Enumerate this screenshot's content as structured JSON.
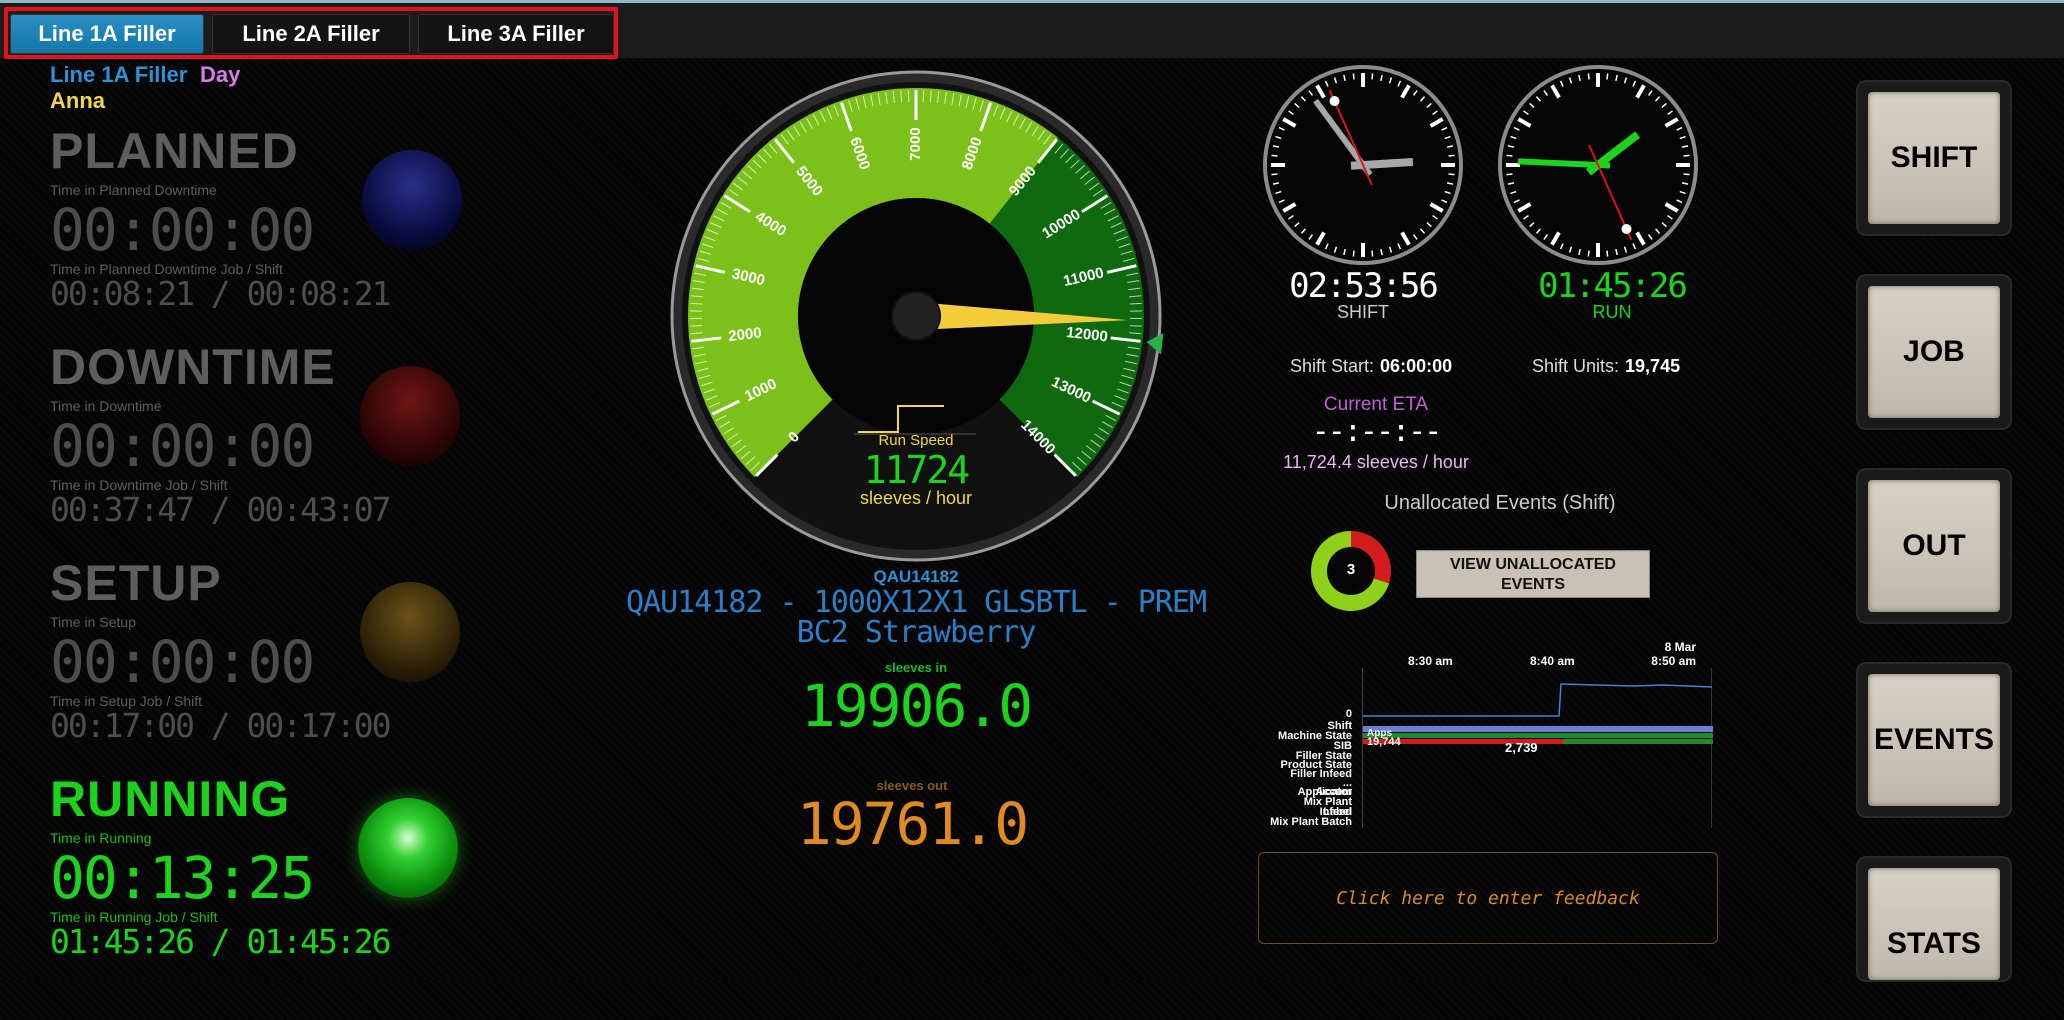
{
  "tabs": [
    {
      "label": "Line 1A Filler",
      "active": true
    },
    {
      "label": "Line 2A Filler",
      "active": false
    },
    {
      "label": "Line 3A Filler",
      "active": false
    }
  ],
  "header": {
    "line_name": "Line 1A Filler",
    "shift_name": "Day",
    "operator": "Anna"
  },
  "states": {
    "planned": {
      "title": "PLANNED",
      "time_label": "Time in Planned Downtime",
      "time": "00:00:00",
      "job_label": "Time in Planned Downtime Job / Shift",
      "job_time": "00:08:21 / 00:08:21"
    },
    "downtime": {
      "title": "DOWNTIME",
      "time_label": "Time in Downtime",
      "time": "00:00:00",
      "job_label": "Time in Downtime Job / Shift",
      "job_time": "00:37:47 / 00:43:07"
    },
    "setup": {
      "title": "SETUP",
      "time_label": "Time in Setup",
      "time": "00:00:00",
      "job_label": "Time in Setup Job / Shift",
      "job_time": "00:17:00 / 00:17:00"
    },
    "running": {
      "title": "RUNNING",
      "time_label": "Time in Running",
      "time": "00:13:25",
      "job_label": "Time in Running Job / Shift",
      "job_time": "01:45:26 / 01:45:26"
    }
  },
  "gauge": {
    "min": 0,
    "max": 14000,
    "value": 11724,
    "target": 12000,
    "ticks": [
      "0",
      "1000",
      "2000",
      "3000",
      "4000",
      "5000",
      "6000",
      "7000",
      "8000",
      "9000",
      "10000",
      "11000",
      "12000",
      "13000",
      "14000"
    ],
    "label": "Run Speed",
    "display_value": "11724",
    "unit": "sleeves / hour"
  },
  "job": {
    "code": "QAU14182",
    "description": "QAU14182 - 1000X12X1 GLSBTL - PREM BC2 Strawberry",
    "sleeves_in_label": "sleeves in",
    "sleeves_in_value": "19906.0",
    "sleeves_out_label": "sleeves out",
    "sleeves_out_value": "19761.0"
  },
  "clocks": {
    "shift": {
      "time": "02:53:56",
      "label": "SHIFT"
    },
    "run": {
      "time": "01:45:26",
      "label": "RUN"
    }
  },
  "shift_info": {
    "start_label": "Shift Start:",
    "start_value": "06:00:00",
    "units_label": "Shift Units:",
    "units_value": "19,745",
    "eta_label": "Current ETA",
    "eta_value": "--:--:--",
    "rate": "11,724.4 sleeves / hour"
  },
  "unallocated": {
    "title": "Unallocated Events (Shift)",
    "count": "3",
    "fraction": 0.3,
    "button": "VIEW UNALLOCATED EVENTS"
  },
  "timeline": {
    "times": [
      "8:30 am",
      "8:40 am",
      "8 Mar 8:50 am"
    ],
    "rows": [
      "0",
      "Shift",
      "Machine State",
      "SIB",
      "Filler State",
      "Product State",
      "Filler Infeed",
      "...",
      "Accum",
      "Applicator",
      "Mix Plant",
      "Label",
      "Infeed",
      "Mix Plant Batch"
    ],
    "bar_labels": {
      "a": "19,744",
      "b": "2,739",
      "c": "Apps"
    }
  },
  "feedback": {
    "placeholder": "Click here to enter feedback"
  },
  "side_buttons": [
    "SHIFT",
    "JOB",
    "OUT",
    "EVENTS",
    "STATS"
  ],
  "colors": {
    "accent": "#1a86bf",
    "green": "#1dd41d",
    "orange": "#e08a1f",
    "purple": "#d67ee8",
    "yellow": "#f2d74b"
  }
}
